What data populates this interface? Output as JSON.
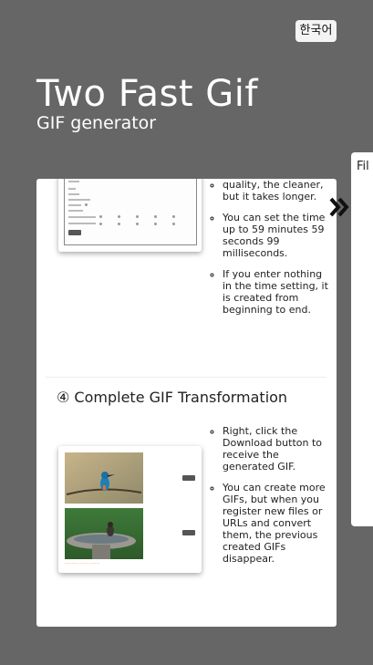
{
  "header": {
    "language_button": "한국어",
    "title": "Two Fast Gif",
    "subtitle": "GIF generator"
  },
  "side_panel": {
    "label": "Fil",
    "icon": "double-chevron-right-icon"
  },
  "step3": {
    "notes": [
      "quality, the cleaner, but it takes longer.",
      "You can set the time up to 59 minutes 59 seconds 99 milliseconds.",
      "If you enter nothing in the time setting, it is created from beginning to end."
    ]
  },
  "step4": {
    "heading": "④ Complete GIF Transformation",
    "notes": [
      "Right, click the Download button to receive the generated GIF.",
      "You can create more GIFs, but when you register new files or URLs and convert them, the previous created GIFs disappear."
    ]
  },
  "colors": {
    "background": "#666666",
    "card": "#ffffff",
    "accent_footnote": "#d98a4a"
  }
}
